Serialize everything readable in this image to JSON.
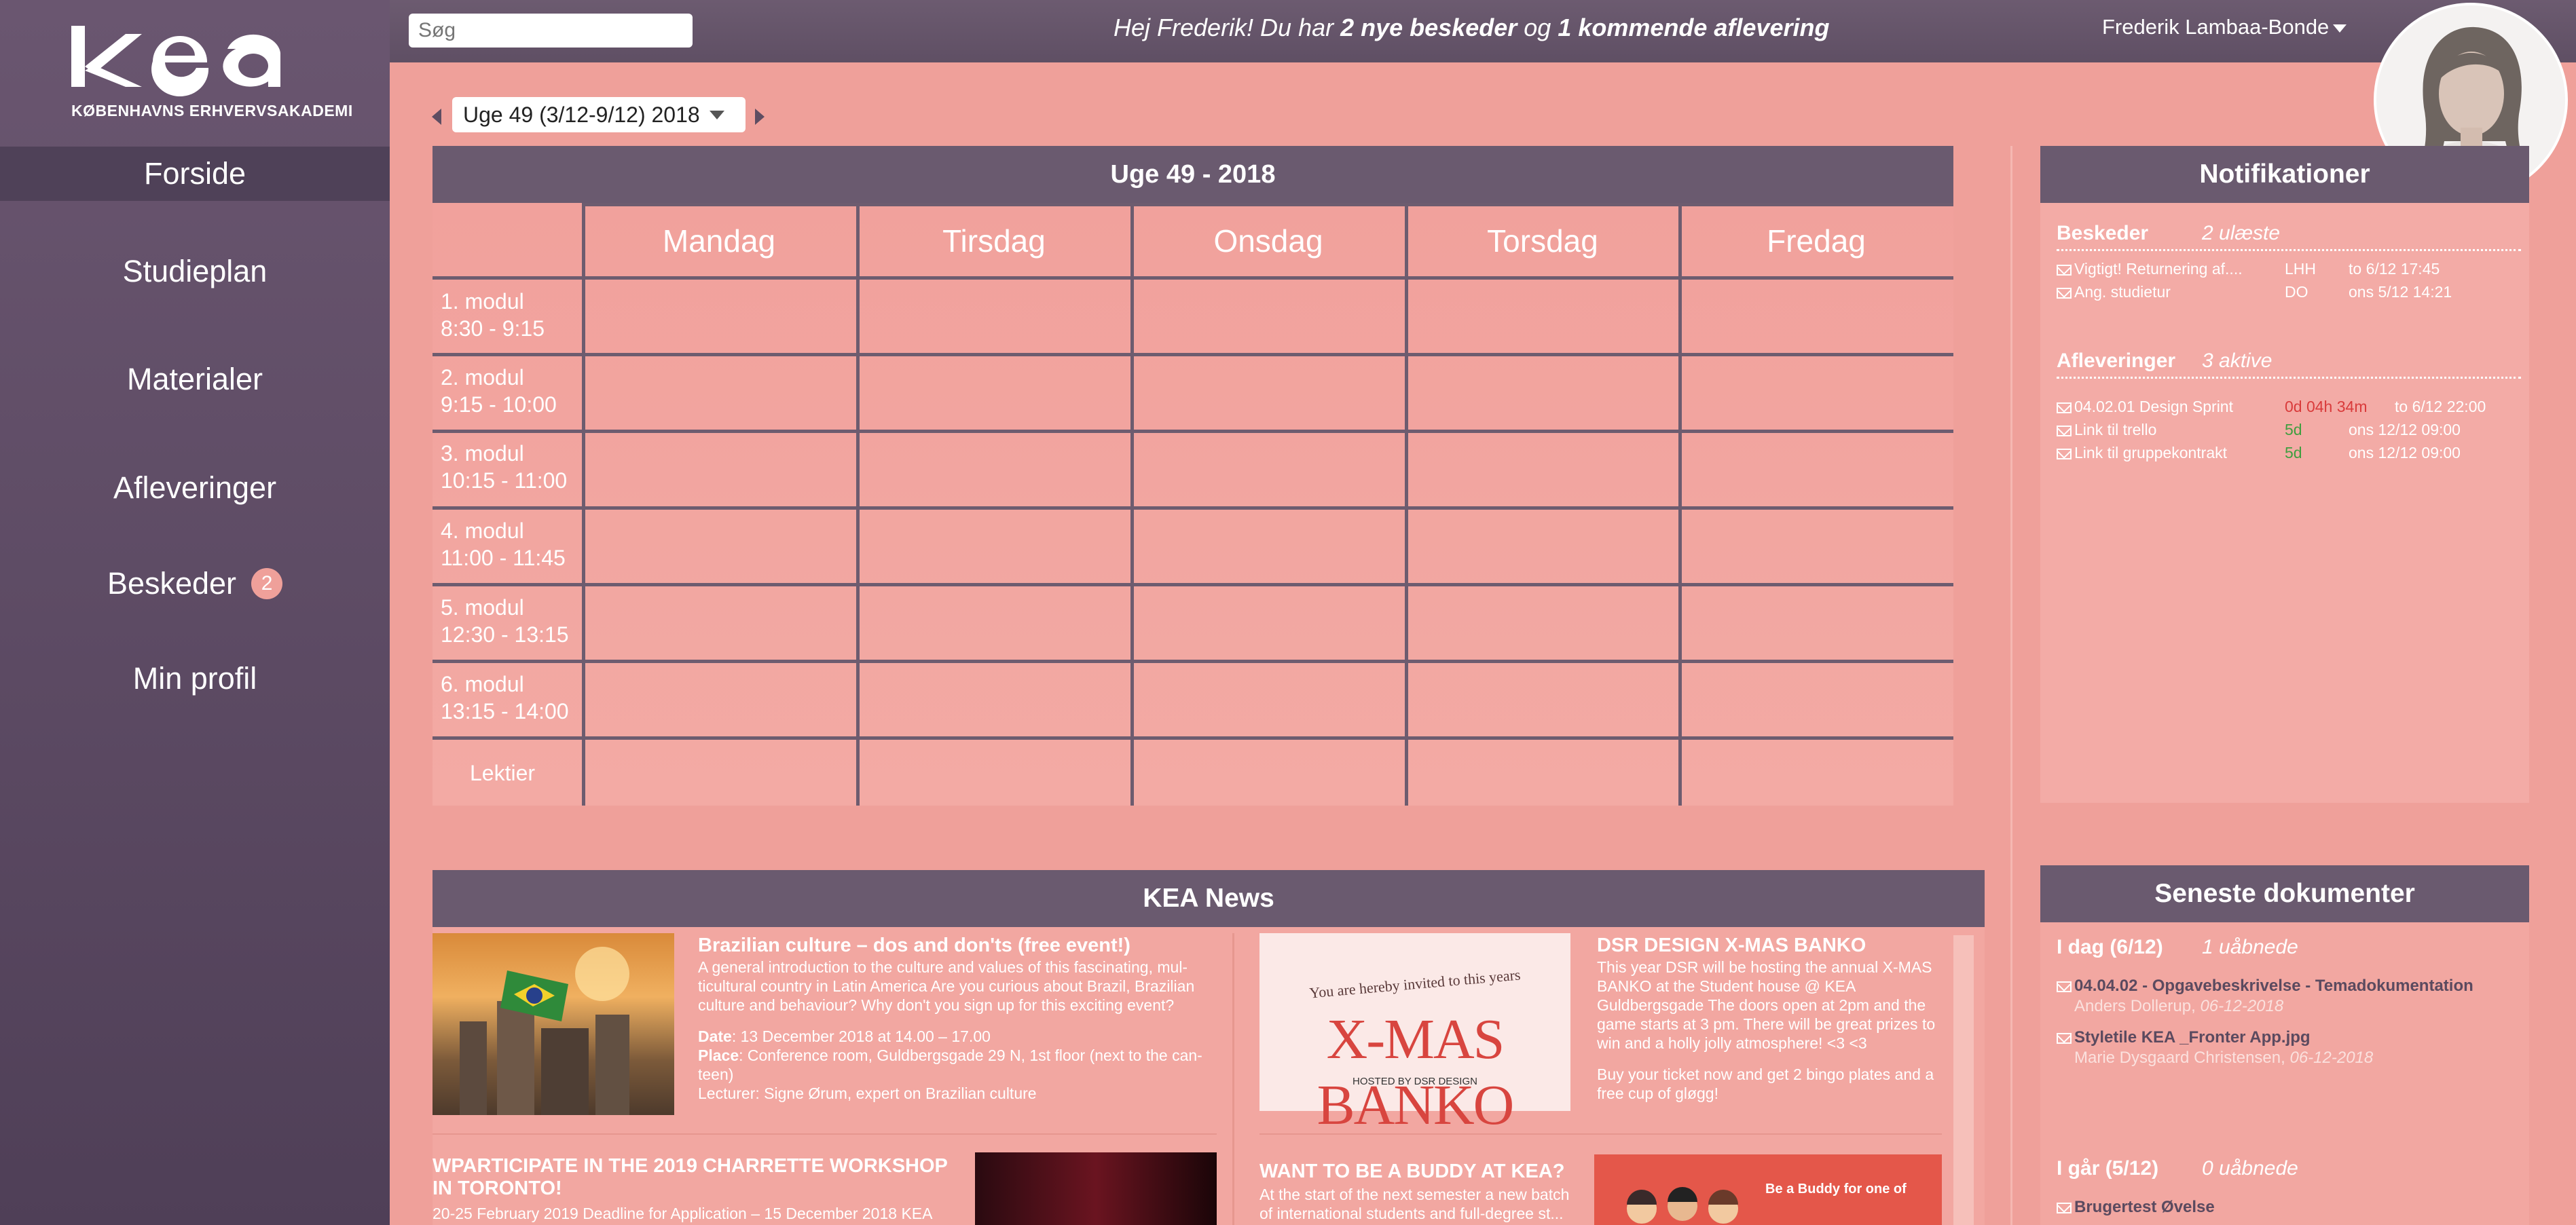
{
  "brand": {
    "logo_text": "kea",
    "subtitle": "KØBENHAVNS ERHVERVSAKADEMI"
  },
  "nav": {
    "items": [
      {
        "label": "Forside",
        "active": true
      },
      {
        "label": "Studieplan"
      },
      {
        "label": "Materialer"
      },
      {
        "label": "Afleveringer"
      },
      {
        "label": "Beskeder",
        "badge": "2"
      },
      {
        "label": "Min profil"
      }
    ]
  },
  "topbar": {
    "search_placeholder": "Søg",
    "greeting_prefix": "Hej Frederik! Du har ",
    "greeting_messages": "2 nye beskeder",
    "greeting_mid": " og ",
    "greeting_assignments": "1 kommende aflevering",
    "user_name": "Frederik Lambaa-Bonde"
  },
  "week": {
    "selected": "Uge 49 (3/12-9/12) 2018"
  },
  "schedule": {
    "title": "Uge 49 - 2018",
    "days": [
      "Mandag",
      "Tirsdag",
      "Onsdag",
      "Torsdag",
      "Fredag"
    ],
    "modules": [
      {
        "name": "1. modul",
        "time": "8:30 - 9:15"
      },
      {
        "name": "2. modul",
        "time": "9:15 - 10:00"
      },
      {
        "name": "3. modul",
        "time": "10:15 - 11:00"
      },
      {
        "name": "4. modul",
        "time": "11:00 - 11:45"
      },
      {
        "name": "5. modul",
        "time": "12:30 - 13:15"
      },
      {
        "name": "6. modul",
        "time": "13:15 - 14:00"
      }
    ],
    "homework_label": "Lektier"
  },
  "notifications": {
    "title": "Notifikationer",
    "messages": {
      "label": "Beskeder",
      "count": "2 ulæste",
      "rows": [
        {
          "subject": "Vigtigt! Returnering af....",
          "from": "LHH",
          "date": "to 6/12 17:45"
        },
        {
          "subject": "Ang. studietur",
          "from": "DO",
          "date": "ons 5/12 14:21"
        }
      ]
    },
    "assignments": {
      "label": "Afleveringer",
      "count": "3 aktive",
      "rows": [
        {
          "subject": "04.02.01 Design Sprint",
          "remaining": "0d 04h 34m",
          "date": "to 6/12 22:00"
        },
        {
          "subject": "Link til trello",
          "remaining": "5d",
          "date": "ons 12/12  09:00"
        },
        {
          "subject": "Link til gruppekontrakt",
          "remaining": "5d",
          "date": "ons 12/12  09:00"
        }
      ]
    }
  },
  "news": {
    "title": "KEA News",
    "items": [
      {
        "title": "Brazilian culture – dos and don'ts (free event!)",
        "body": "A general introduction to the culture and values of this fascinating, mul-ticultural country in Latin America Are you curious about Brazil, Brazilian culture and behaviour? Why don't you sign up for this exciting event?",
        "date_label": "Date",
        "date": ": 13 December 2018 at 14.00 – 17.00",
        "place_label": "Place",
        "place": ": Conference room, Guldbergsgade 29 N, 1st floor (next to the can-teen)",
        "lecturer": " Lecturer: Signe Ørum, expert on Brazilian culture"
      },
      {
        "title": "DSR DESIGN X-MAS BANKO",
        "body": "This year DSR will be hosting the annual X-MAS BANKO at the Student house @ KEA Guldbergsgade The doors open at 2pm and the game starts at 3 pm. There will be great prizes to win and a holly jolly atmosphere! <3 <3",
        "body2": "Buy your ticket now and get 2 bingo plates and a free cup of gløgg!",
        "poster_top": "You are hereby invited to this years",
        "poster_main": "X-MAS BANKO",
        "poster_sub": "HOSTED BY DSR DESIGN"
      },
      {
        "title": "WPARTICIPATE IN THE 2019 CHARRETTE WORKSHOP IN TORONTO!",
        "body": "20-25 February 2019 Deadline for Application – 15 December 2018 KEA"
      },
      {
        "title": "WANT TO BE A BUDDY AT KEA?",
        "body": "At the start of the next semester a new batch of international students and full-degree st...",
        "poster_text": "Be a Buddy for one of"
      }
    ]
  },
  "documents": {
    "title": "Seneste dokumenter",
    "today_label": "I dag (6/12)",
    "today_count": "1 uåbnede",
    "today": [
      {
        "title": "04.04.02 - Opgavebeskrivelse - Temadokumentation",
        "author": "Anders Dollerup",
        "date": "06-12-2018"
      },
      {
        "title": "Styletile KEA _Fronter App.jpg",
        "author": "Marie Dysgaard Christensen",
        "date": "06-12-2018"
      }
    ],
    "yesterday_label": "I går (5/12)",
    "yesterday_count": "0 uåbnede",
    "yesterday": [
      {
        "title": "Brugertest Øvelse"
      }
    ]
  },
  "colors": {
    "sidebar": "#5c4a63",
    "header": "#6a5a6f",
    "background": "#efa09a",
    "overdue": "#d93b3b",
    "ok": "#3f9e3f"
  }
}
